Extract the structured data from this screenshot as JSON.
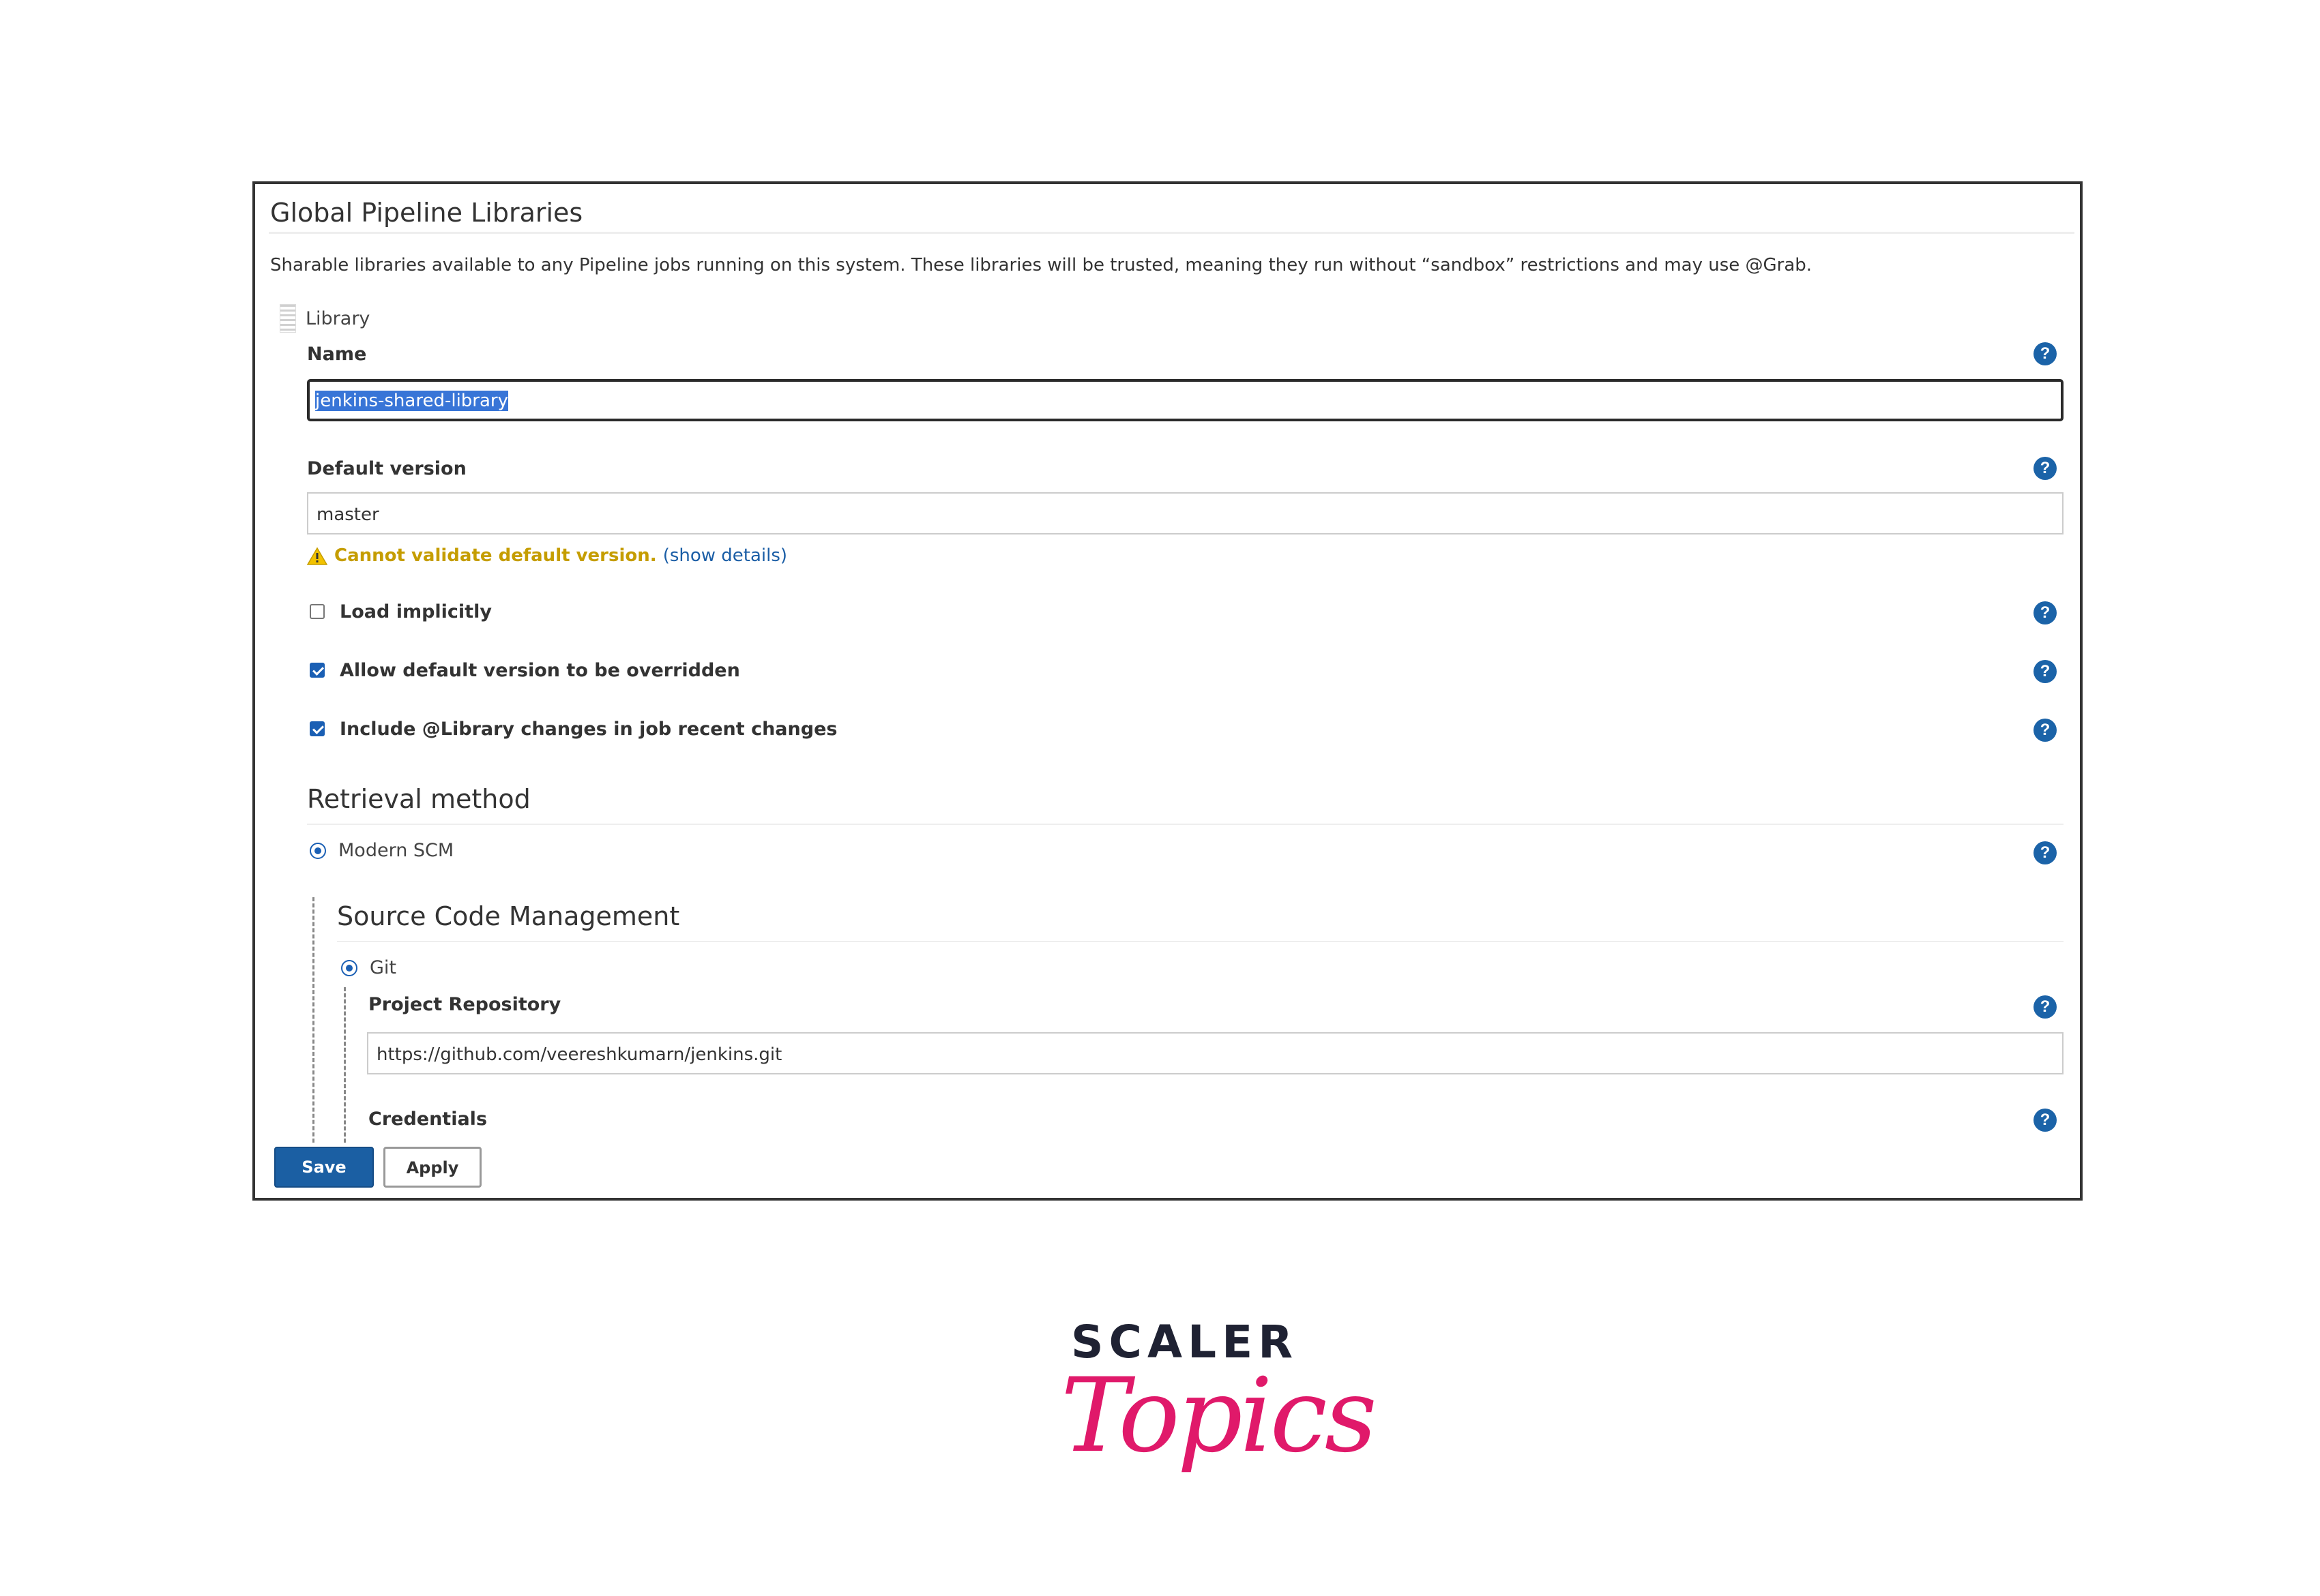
{
  "panel": {
    "title": "Global Pipeline Libraries",
    "description": "Sharable libraries available to any Pipeline jobs running on this system. These libraries will be trusted, meaning they run without “sandbox” restrictions and may use @Grab."
  },
  "library": {
    "section_label": "Library",
    "name_label": "Name",
    "name_value": "jenkins-shared-library",
    "default_version_label": "Default version",
    "default_version_value": "master",
    "warning_text": "Cannot validate default version.",
    "warning_link": "(show details)",
    "load_implicitly_label": "Load implicitly",
    "load_implicitly_checked": false,
    "allow_override_label": "Allow default version to be overridden",
    "allow_override_checked": true,
    "include_changes_label": "Include @Library changes in job recent changes",
    "include_changes_checked": true
  },
  "retrieval": {
    "heading": "Retrieval method",
    "option_label": "Modern SCM",
    "scm": {
      "heading": "Source Code Management",
      "option_label": "Git",
      "repo_label": "Project Repository",
      "repo_value": "https://github.com/veereshkumarn/jenkins.git",
      "credentials_label": "Credentials"
    }
  },
  "help_glyph": "?",
  "actions": {
    "save_label": "Save",
    "apply_label": "Apply"
  },
  "branding": {
    "line1": "SCALER",
    "line2": "Topics"
  },
  "colors": {
    "accent": "#1b5fa3",
    "warning": "#c59d00",
    "brand_pink": "#e0196a",
    "brand_dark": "#1f2233"
  }
}
